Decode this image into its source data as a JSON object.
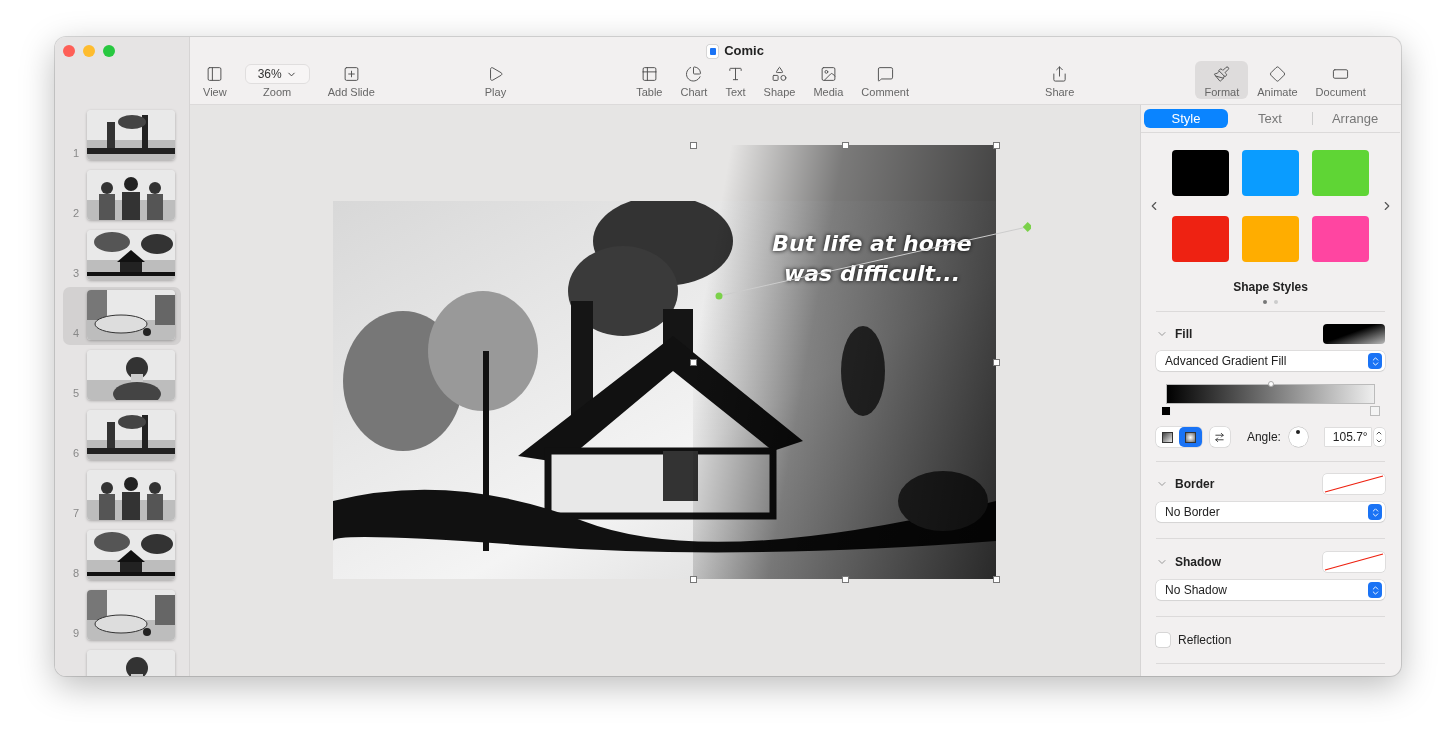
{
  "window": {
    "title": "Comic"
  },
  "toolbar": {
    "groups": [
      [
        {
          "label": "View",
          "kind": "button",
          "selected": false
        },
        {
          "label": "Zoom",
          "kind": "dropdown",
          "value": "36%",
          "selected": false
        },
        {
          "label": "Add Slide",
          "kind": "button",
          "selected": false
        }
      ],
      [
        {
          "label": "Play",
          "kind": "button",
          "selected": false
        }
      ],
      [
        {
          "label": "Table",
          "kind": "button",
          "selected": false
        },
        {
          "label": "Chart",
          "kind": "button",
          "selected": false
        },
        {
          "label": "Text",
          "kind": "button",
          "selected": false
        },
        {
          "label": "Shape",
          "kind": "button",
          "selected": false
        },
        {
          "label": "Media",
          "kind": "button",
          "selected": false
        },
        {
          "label": "Comment",
          "kind": "button",
          "selected": false
        }
      ],
      [
        {
          "label": "Share",
          "kind": "button",
          "selected": false
        }
      ],
      [
        {
          "label": "Format",
          "kind": "button",
          "selected": true
        },
        {
          "label": "Animate",
          "kind": "button",
          "selected": false
        },
        {
          "label": "Document",
          "kind": "button",
          "selected": false
        }
      ]
    ]
  },
  "slides": [
    {
      "number": "1",
      "selected": false
    },
    {
      "number": "2",
      "selected": false
    },
    {
      "number": "3",
      "selected": false
    },
    {
      "number": "4",
      "selected": true
    },
    {
      "number": "5",
      "selected": false
    },
    {
      "number": "6",
      "selected": false
    },
    {
      "number": "7",
      "selected": false
    },
    {
      "number": "8",
      "selected": false
    },
    {
      "number": "9",
      "selected": false
    },
    {
      "selected": false
    }
  ],
  "slide": {
    "caption": "But life at home was difficult..."
  },
  "inspector": {
    "tabs": [
      {
        "label": "Style",
        "selected": true
      },
      {
        "label": "Text",
        "selected": false
      },
      {
        "label": "Arrange",
        "selected": false
      }
    ],
    "shape_styles": {
      "title": "Shape Styles",
      "swatches": [
        {
          "color": "#000000"
        },
        {
          "color": "#0a9cff"
        },
        {
          "color": "#5fd535"
        },
        {
          "color": "#ee2212"
        },
        {
          "color": "#ffad00"
        },
        {
          "color": "#ff45a1"
        }
      ],
      "pages": [
        {
          "selected": true
        },
        {
          "selected": false
        }
      ]
    },
    "fill": {
      "title": "Fill",
      "expanded": true,
      "value": "Advanced Gradient Fill",
      "level": 0.5,
      "types": [
        {
          "selected": false
        },
        {
          "selected": true
        }
      ],
      "angle_label": "Angle:",
      "angle": "105.7°"
    },
    "border": {
      "title": "Border",
      "expanded": true,
      "value": "No Border"
    },
    "shadow": {
      "title": "Shadow",
      "expanded": true,
      "value": "No Shadow"
    },
    "reflection": {
      "label": "Reflection",
      "checked": false
    }
  }
}
